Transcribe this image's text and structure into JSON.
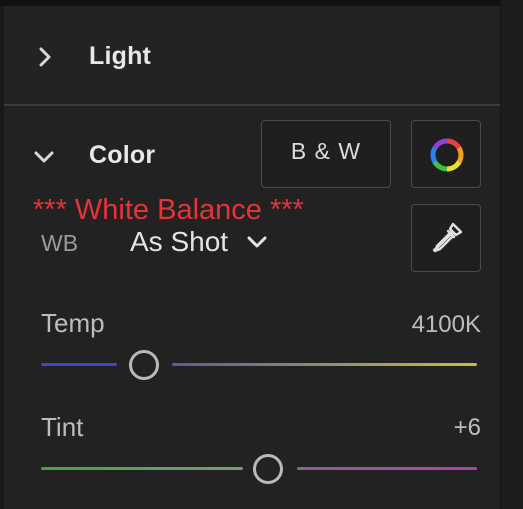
{
  "light_section": {
    "title": "Light",
    "expanded": false
  },
  "color_section": {
    "title": "Color",
    "expanded": true,
    "bw_button_label": "B & W",
    "color_mixer_icon": "color-wheel-icon"
  },
  "annotation": {
    "text": "*** White Balance ***",
    "color": "#e8323a"
  },
  "white_balance": {
    "label": "WB",
    "selected_preset": "As Shot",
    "dropdown_icon": "chevron-down-icon",
    "picker_icon": "eyedropper-icon"
  },
  "temp": {
    "label": "Temp",
    "value": "4100K",
    "track_gradient": [
      "#4545c8",
      "#c8c040"
    ]
  },
  "tint": {
    "label": "Tint",
    "value": "+6",
    "track_gradient": [
      "#3ea83e",
      "#b040b0"
    ]
  }
}
